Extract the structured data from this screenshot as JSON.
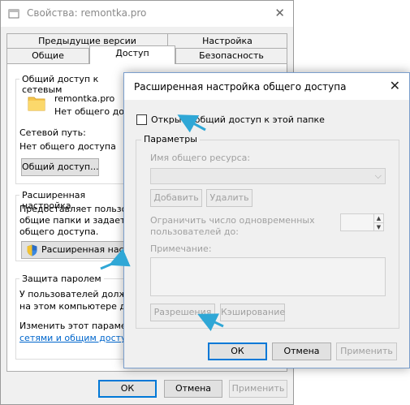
{
  "props_window": {
    "title": "Свойства: remontka.pro",
    "close": "✕",
    "tabs_row1": [
      "Предыдущие версии",
      "Настройка"
    ],
    "tabs_row2": [
      "Общие",
      "Доступ",
      "Безопасность"
    ],
    "share_group": {
      "title": "Общий доступ к сетевым",
      "folder_name": "remontka.pro",
      "folder_status": "Нет общего доступа",
      "path_label": "Сетевой путь:",
      "path_value": "Нет общего доступа",
      "share_button": "Общий доступ..."
    },
    "advanced_group": {
      "title": "Расширенная настройка",
      "desc1": "Предоставляет пользов",
      "desc2": "общие папки и задает д",
      "desc3": "общего доступа.",
      "button": "Расширенная наст"
    },
    "password_group": {
      "title": "Защита паролем",
      "line1": "У пользователей долж",
      "line2": "на этом компьютере дл",
      "line3": "Изменить этот парамет",
      "link": "сетями и общим доступ"
    },
    "buttons": {
      "ok": "ОК",
      "cancel": "Отмена",
      "apply": "Применить"
    }
  },
  "adv_dialog": {
    "title": "Расширенная настройка общего доступа",
    "close": "✕",
    "share_checkbox_label": "Открыть общий доступ к этой папке",
    "share_checked": false,
    "params_legend": "Параметры",
    "share_name_label": "Имя общего ресурса:",
    "add_button": "Добавить",
    "remove_button": "Удалить",
    "limit_label1": "Ограничить число одновременных",
    "limit_label2": "пользователей до:",
    "comment_label": "Примечание:",
    "permissions_button": "Разрешения",
    "caching_button": "Кэширование",
    "ok": "ОК",
    "cancel": "Отмена",
    "apply": "Применить"
  },
  "colors": {
    "accent": "#0078d7",
    "arrow": "#2fa7d6",
    "folder": "#f6c64f"
  },
  "icons": [
    "window-icon",
    "folder-icon",
    "shield-icon",
    "close-icon"
  ]
}
